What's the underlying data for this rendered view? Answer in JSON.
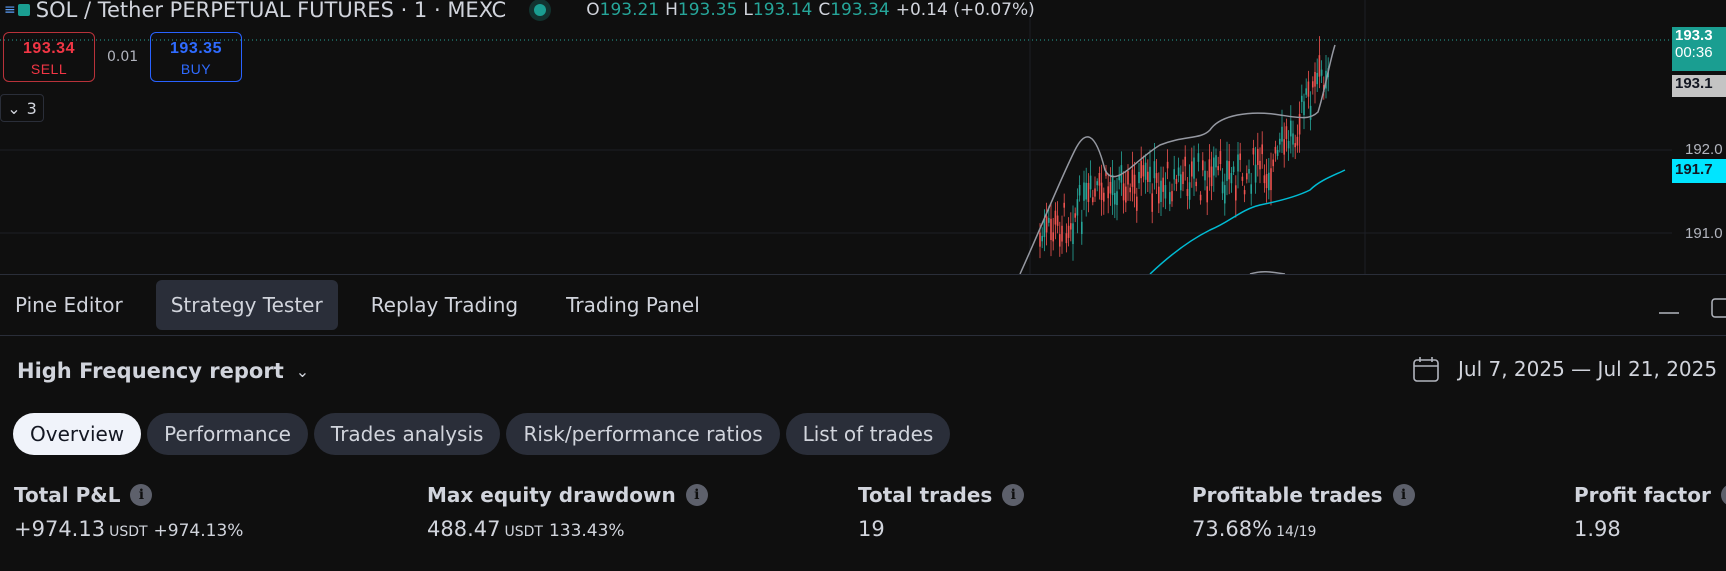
{
  "chart": {
    "symbol_title": "SOL / Tether PERPETUAL FUTURES · 1 · MEXC",
    "ohlc": {
      "open_label": "O",
      "open": "193.21",
      "high_label": "H",
      "high": "193.35",
      "low_label": "L",
      "low": "193.14",
      "close_label": "C",
      "close": "193.34",
      "change": "+0.14 (+0.07%)"
    },
    "sell": {
      "price": "193.34",
      "label": "SELL"
    },
    "buy": {
      "price": "193.35",
      "label": "BUY"
    },
    "spread": "0.01",
    "indicators_count": "3",
    "price_axis": {
      "last_price": "193.3",
      "countdown": "00:36",
      "bid_tag": "193.1",
      "ma_tag": "191.7",
      "tick_192": "192.0",
      "tick_191": "191.0"
    },
    "colors": {
      "up": "#26a69a",
      "down": "#ef5350",
      "ma": "#00bcd4",
      "bands": "#9598a1"
    }
  },
  "panel": {
    "tabs": [
      "Pine Editor",
      "Strategy Tester",
      "Replay Trading",
      "Trading Panel"
    ],
    "active_tab": "Strategy Tester",
    "report_title": "High Frequency report",
    "date_range": "Jul 7, 2025 — Jul 21, 2025",
    "subtabs": [
      "Overview",
      "Performance",
      "Trades analysis",
      "Risk/performance ratios",
      "List of trades"
    ],
    "active_subtab": "Overview",
    "metrics": {
      "total_pnl": {
        "label": "Total P&L",
        "value": "+974.13",
        "unit": "USDT",
        "pct": "+974.13%"
      },
      "max_drawdown": {
        "label": "Max equity drawdown",
        "value": "488.47",
        "unit": "USDT",
        "pct": "133.43%"
      },
      "total_trades": {
        "label": "Total trades",
        "value": "19"
      },
      "profitable_trades": {
        "label": "Profitable trades",
        "value": "73.68%",
        "ratio": "14/19"
      },
      "profit_factor": {
        "label": "Profit factor",
        "value": "1.98"
      }
    }
  }
}
